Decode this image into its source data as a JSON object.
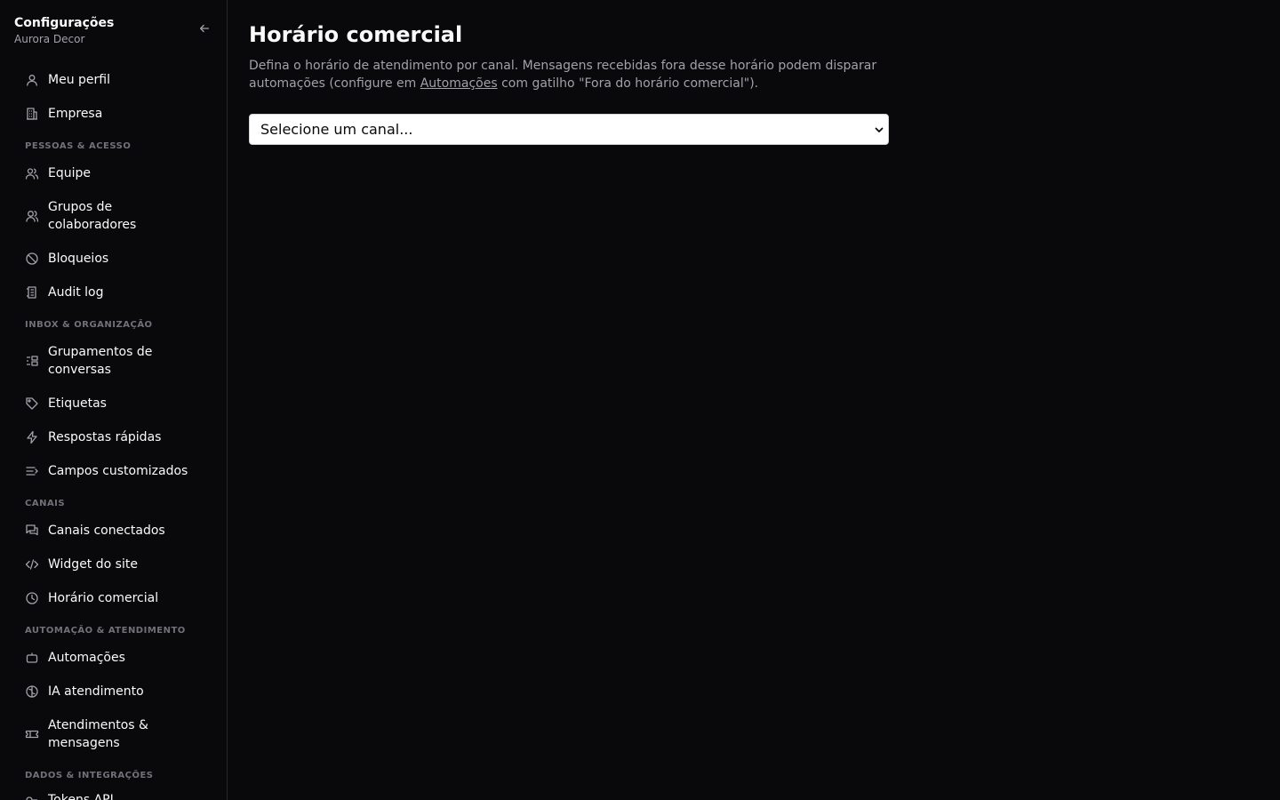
{
  "sidebar": {
    "title": "Configurações",
    "subtitle": "Aurora Decor",
    "items": {
      "meu_perfil": "Meu perfil",
      "empresa": "Empresa",
      "equipe": "Equipe",
      "grupos": "Grupos de colaboradores",
      "bloqueios": "Bloqueios",
      "audit_log": "Audit log",
      "grupamentos": "Grupamentos de conversas",
      "etiquetas": "Etiquetas",
      "respostas": "Respostas rápidas",
      "campos": "Campos customizados",
      "canais_conectados": "Canais conectados",
      "widget": "Widget do site",
      "horario": "Horário comercial",
      "automacoes": "Automações",
      "ia": "IA atendimento",
      "atendimentos": "Atendimentos & mensagens",
      "tokens": "Tokens API"
    },
    "sections": {
      "pessoas": "PESSOAS & ACESSO",
      "inbox": "INBOX & ORGANIZAÇÃO",
      "canais": "CANAIS",
      "automacao": "AUTOMAÇÃO & ATENDIMENTO",
      "dados": "DADOS & INTEGRAÇÕES"
    }
  },
  "main": {
    "title": "Horário comercial",
    "description_part1": "Defina o horário de atendimento por canal. Mensagens recebidas fora desse horário podem disparar automações (configure em ",
    "description_link": "Automações",
    "description_part2": " com gatilho \"Fora do horário comercial\").",
    "select_value": "Selecione um canal..."
  },
  "icons": {
    "sidebar": [
      "arrow-left-icon",
      "user-icon",
      "building-icon",
      "users-icon",
      "users-round-icon",
      "ban-icon",
      "file-log-icon",
      "group-icon",
      "tag-icon",
      "zap-icon",
      "text-list-icon",
      "chats-icon",
      "code-icon",
      "clock-icon",
      "bot-icon",
      "brain-icon",
      "ticket-icon",
      "key-icon"
    ],
    "main": [
      "chevron-down-icon"
    ]
  },
  "colors": {
    "background": "#09090b",
    "text": "#fafafa",
    "muted": "#a1a1aa",
    "section": "#71717a",
    "border": "#27272a"
  }
}
